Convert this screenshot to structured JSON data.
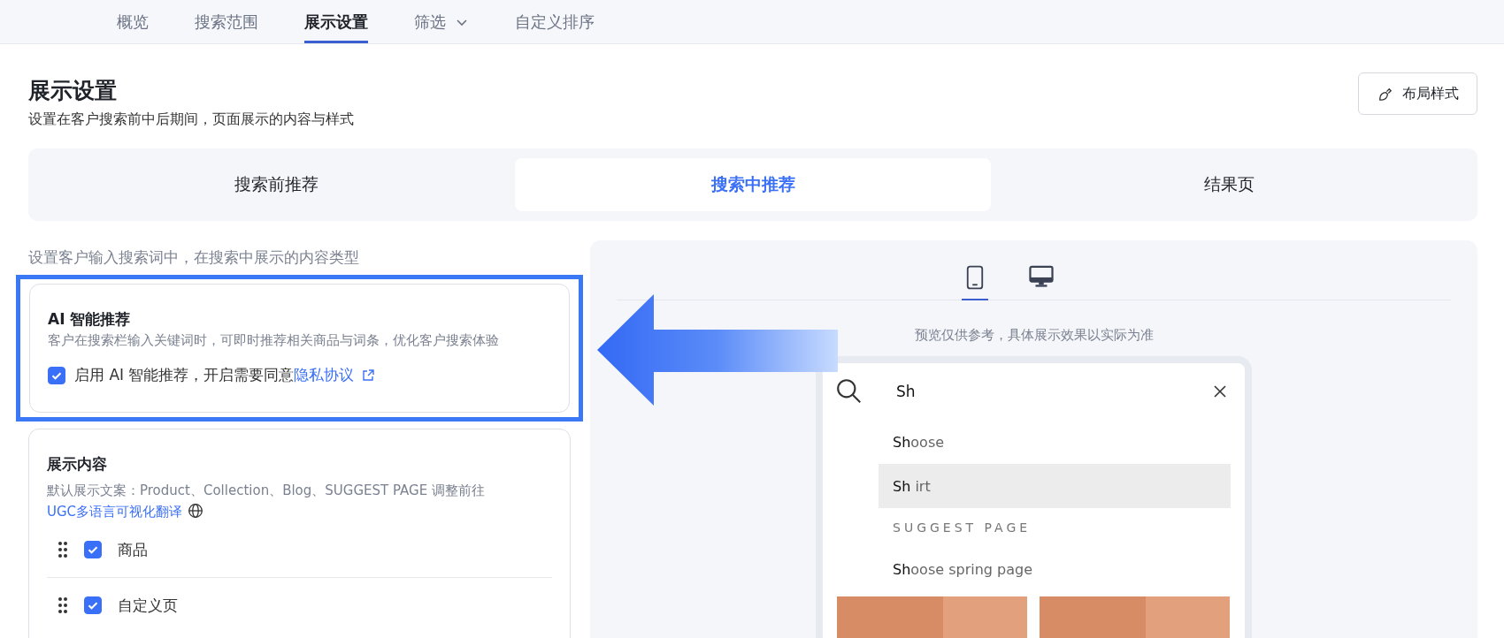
{
  "nav_tabs": [
    {
      "label": "概览",
      "selected": false,
      "dropdown": false
    },
    {
      "label": "搜索范围",
      "selected": false,
      "dropdown": false
    },
    {
      "label": "展示设置",
      "selected": true,
      "dropdown": false
    },
    {
      "label": "筛选",
      "selected": false,
      "dropdown": true
    },
    {
      "label": "自定义排序",
      "selected": false,
      "dropdown": false
    }
  ],
  "header": {
    "title": "展示设置",
    "subtitle": "设置在客户搜索前中后期间，页面展示的内容与样式",
    "layout_button": "布局样式"
  },
  "segments": [
    {
      "label": "搜索前推荐",
      "selected": false
    },
    {
      "label": "搜索中推荐",
      "selected": true
    },
    {
      "label": "结果页",
      "selected": false
    }
  ],
  "settings": {
    "hint": "设置客户输入搜索词中，在搜索中展示的内容类型",
    "ai_card": {
      "highlighted": true,
      "title": "AI 智能推荐",
      "description": "客户在搜索栏输入关键词时，可即时推荐相关商品与词条，优化客户搜索体验",
      "checkbox": {
        "checked": true,
        "label": "启用 AI 智能推荐，开启需要同意",
        "link": "隐私协议"
      }
    },
    "content_card": {
      "title": "展示内容",
      "description": "默认展示文案：Product、Collection、Blog、SUGGEST PAGE 调整前往",
      "link": "UGC多语言可视化翻译",
      "items": [
        {
          "label": "商品",
          "checked": true
        },
        {
          "label": "自定义页",
          "checked": true
        }
      ]
    }
  },
  "preview": {
    "devices": [
      {
        "kind": "phone",
        "selected": true
      },
      {
        "kind": "desktop",
        "selected": false
      }
    ],
    "note": "预览仅供参考，具体展示效果以实际为准",
    "search": {
      "value": "Sh"
    },
    "suggestions": [
      {
        "text": "**Sh**oose",
        "selected": false
      },
      {
        "text": "**Sh** irt",
        "selected": true
      }
    ],
    "section_title": "SUGGEST PAGE",
    "pages": [
      "**Sh**oose spring page"
    ],
    "products": [
      {
        "kind": "picture"
      },
      {
        "kind": "picture"
      }
    ]
  }
}
